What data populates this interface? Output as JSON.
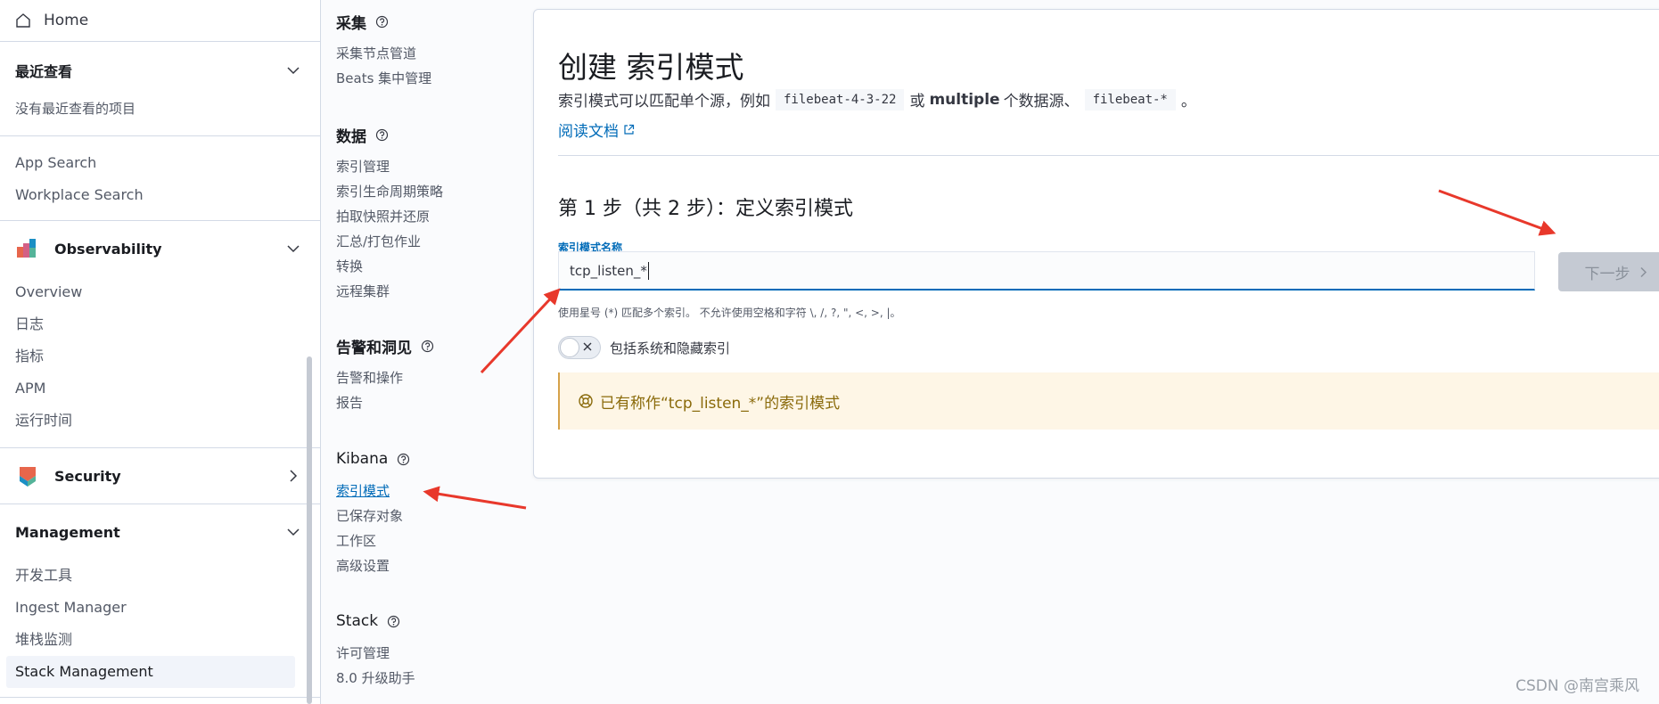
{
  "nav": {
    "home": "Home",
    "recent": {
      "title": "最近查看",
      "empty": "没有最近查看的项目"
    },
    "search_links": [
      "App Search",
      "Workplace Search"
    ],
    "observability": {
      "title": "Observability",
      "items": [
        "Overview",
        "日志",
        "指标",
        "APM",
        "运行时间"
      ]
    },
    "security": {
      "title": "Security"
    },
    "management": {
      "title": "Management",
      "items": [
        "开发工具",
        "Ingest Manager",
        "堆栈监测",
        "Stack Management"
      ]
    }
  },
  "mgmt": {
    "ingest": {
      "title": "采集",
      "items": [
        "采集节点管道",
        "Beats 集中管理"
      ]
    },
    "data": {
      "title": "数据",
      "items": [
        "索引管理",
        "索引生命周期策略",
        "拍取快照并还原",
        "汇总/打包作业",
        "转换",
        "远程集群"
      ]
    },
    "alerts": {
      "title": "告警和洞见",
      "items": [
        "告警和操作",
        "报告"
      ]
    },
    "kibana": {
      "title": "Kibana",
      "items": [
        "索引模式",
        "已保存对象",
        "工作区",
        "高级设置"
      ]
    },
    "stack": {
      "title": "Stack",
      "items": [
        "许可管理",
        "8.0 升级助手"
      ]
    }
  },
  "panel": {
    "title": "创建 索引模式",
    "desc_prefix": "索引模式可以匹配单个源，例如",
    "desc_code1": "filebeat-4-3-22",
    "desc_or": "或",
    "desc_bold": "multiple",
    "desc_mid": "个数据源、",
    "desc_code2": "filebeat-*",
    "desc_end": "。",
    "doc_link": "阅读文档",
    "step": "第 1 步（共 2 步）：定义索引模式",
    "field_label": "索引模式名称",
    "field_value": "tcp_listen_*",
    "next_button": "下一步",
    "help_text": "使用星号 (*) 匹配多个索引。 不允许使用空格和字符 \\, /, ?, \", <, >, |。",
    "toggle_label": "包括系统和隐藏索引",
    "callout": "已有称作“tcp_listen_*”的索引模式"
  },
  "watermark": "CSDN @南宫乘风",
  "colors": {
    "accent": "#006bb8",
    "arrow": "#e8382b",
    "warning_bg": "#fef6e6"
  }
}
